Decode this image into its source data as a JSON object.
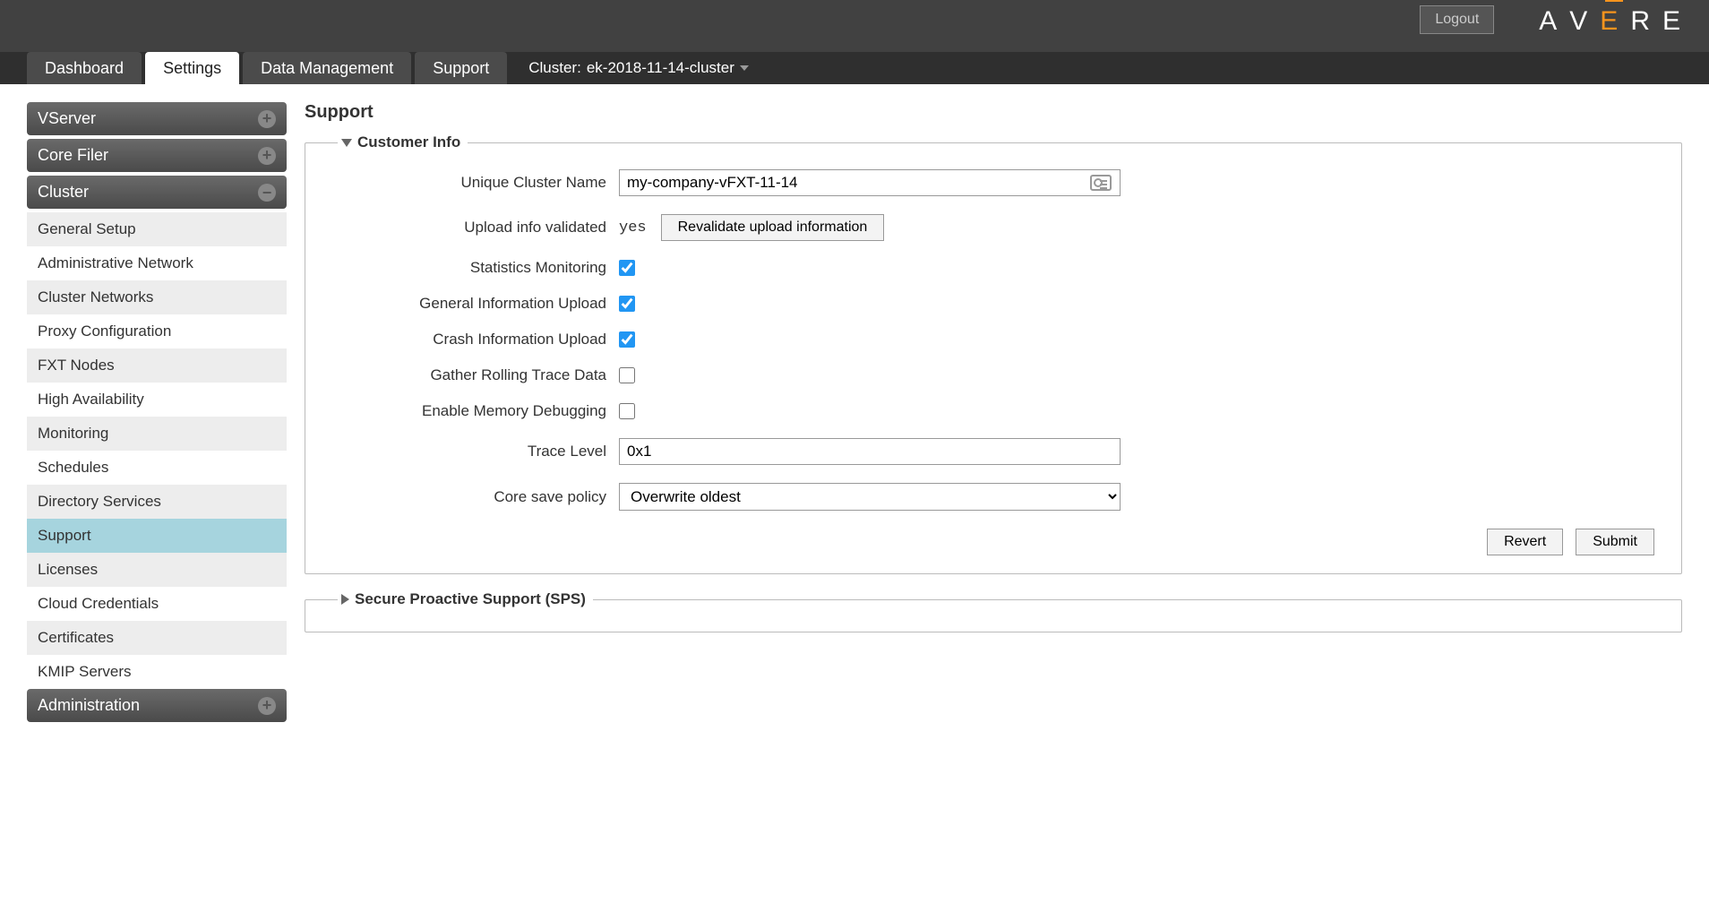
{
  "header": {
    "logout": "Logout",
    "logo_letters": [
      "A",
      "V",
      "E",
      "R",
      "E"
    ]
  },
  "nav": {
    "tabs": [
      {
        "label": "Dashboard",
        "active": false
      },
      {
        "label": "Settings",
        "active": true
      },
      {
        "label": "Data Management",
        "active": false
      },
      {
        "label": "Support",
        "active": false
      }
    ],
    "cluster_prefix": "Cluster: ",
    "cluster_name": "ek-2018-11-14-cluster"
  },
  "sidebar": {
    "sections": [
      {
        "title": "VServer",
        "expanded": false,
        "items": []
      },
      {
        "title": "Core Filer",
        "expanded": false,
        "items": []
      },
      {
        "title": "Cluster",
        "expanded": true,
        "items": [
          "General Setup",
          "Administrative Network",
          "Cluster Networks",
          "Proxy Configuration",
          "FXT Nodes",
          "High Availability",
          "Monitoring",
          "Schedules",
          "Directory Services",
          "Support",
          "Licenses",
          "Cloud Credentials",
          "Certificates",
          "KMIP Servers"
        ],
        "selected": "Support"
      },
      {
        "title": "Administration",
        "expanded": false,
        "items": []
      }
    ]
  },
  "page": {
    "title": "Support",
    "customer_info": {
      "legend": "Customer Info",
      "fields": {
        "unique_cluster_name": {
          "label": "Unique Cluster Name",
          "value": "my-company-vFXT-11-14"
        },
        "upload_info_validated": {
          "label": "Upload info validated",
          "value": "yes",
          "button": "Revalidate upload information"
        },
        "statistics_monitoring": {
          "label": "Statistics Monitoring",
          "checked": true
        },
        "general_info_upload": {
          "label": "General Information Upload",
          "checked": true
        },
        "crash_info_upload": {
          "label": "Crash Information Upload",
          "checked": true
        },
        "gather_rolling_trace": {
          "label": "Gather Rolling Trace Data",
          "checked": false
        },
        "enable_memory_debugging": {
          "label": "Enable Memory Debugging",
          "checked": false
        },
        "trace_level": {
          "label": "Trace Level",
          "value": "0x1"
        },
        "core_save_policy": {
          "label": "Core save policy",
          "value": "Overwrite oldest"
        }
      },
      "buttons": {
        "revert": "Revert",
        "submit": "Submit"
      }
    },
    "sps": {
      "legend": "Secure Proactive Support (SPS)"
    }
  }
}
